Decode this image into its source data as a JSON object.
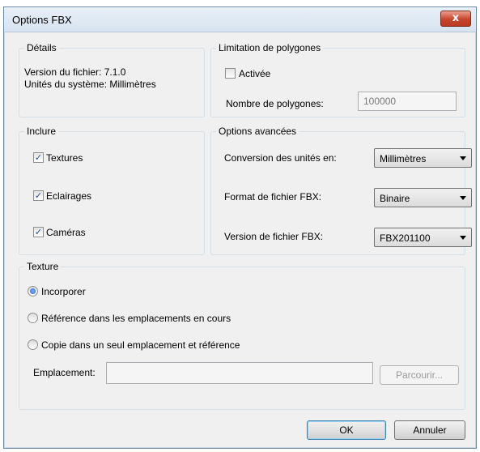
{
  "window": {
    "title": "Options FBX",
    "close_label": "x"
  },
  "details": {
    "legend": "Détails",
    "file_version": "Version du fichier: 7.1.0",
    "system_units": "Unités du système: Millimètres"
  },
  "polygon_limit": {
    "legend": "Limitation de polygones",
    "enabled_label": "Activée",
    "enabled_checked": false,
    "count_label": "Nombre de polygones:",
    "count_value": "100000"
  },
  "include": {
    "legend": "Inclure",
    "items": [
      {
        "label": "Textures",
        "checked": true
      },
      {
        "label": "Eclairages",
        "checked": true
      },
      {
        "label": "Caméras",
        "checked": true
      }
    ]
  },
  "advanced": {
    "legend": "Options avancées",
    "unit_conversion_label": "Conversion des unités en:",
    "unit_conversion_value": "Millimètres",
    "format_label": "Format de fichier FBX:",
    "format_value": "Binaire",
    "version_label": "Version de fichier FBX:",
    "version_value": "FBX201100"
  },
  "texture": {
    "legend": "Texture",
    "options": [
      {
        "label": "Incorporer",
        "selected": true
      },
      {
        "label": "Référence dans les emplacements en cours",
        "selected": false
      },
      {
        "label": "Copie dans un seul emplacement et référence",
        "selected": false
      }
    ],
    "location_label": "Emplacement:",
    "location_value": "",
    "browse_label": "Parcourir..."
  },
  "footer": {
    "ok_label": "OK",
    "cancel_label": "Annuler"
  }
}
